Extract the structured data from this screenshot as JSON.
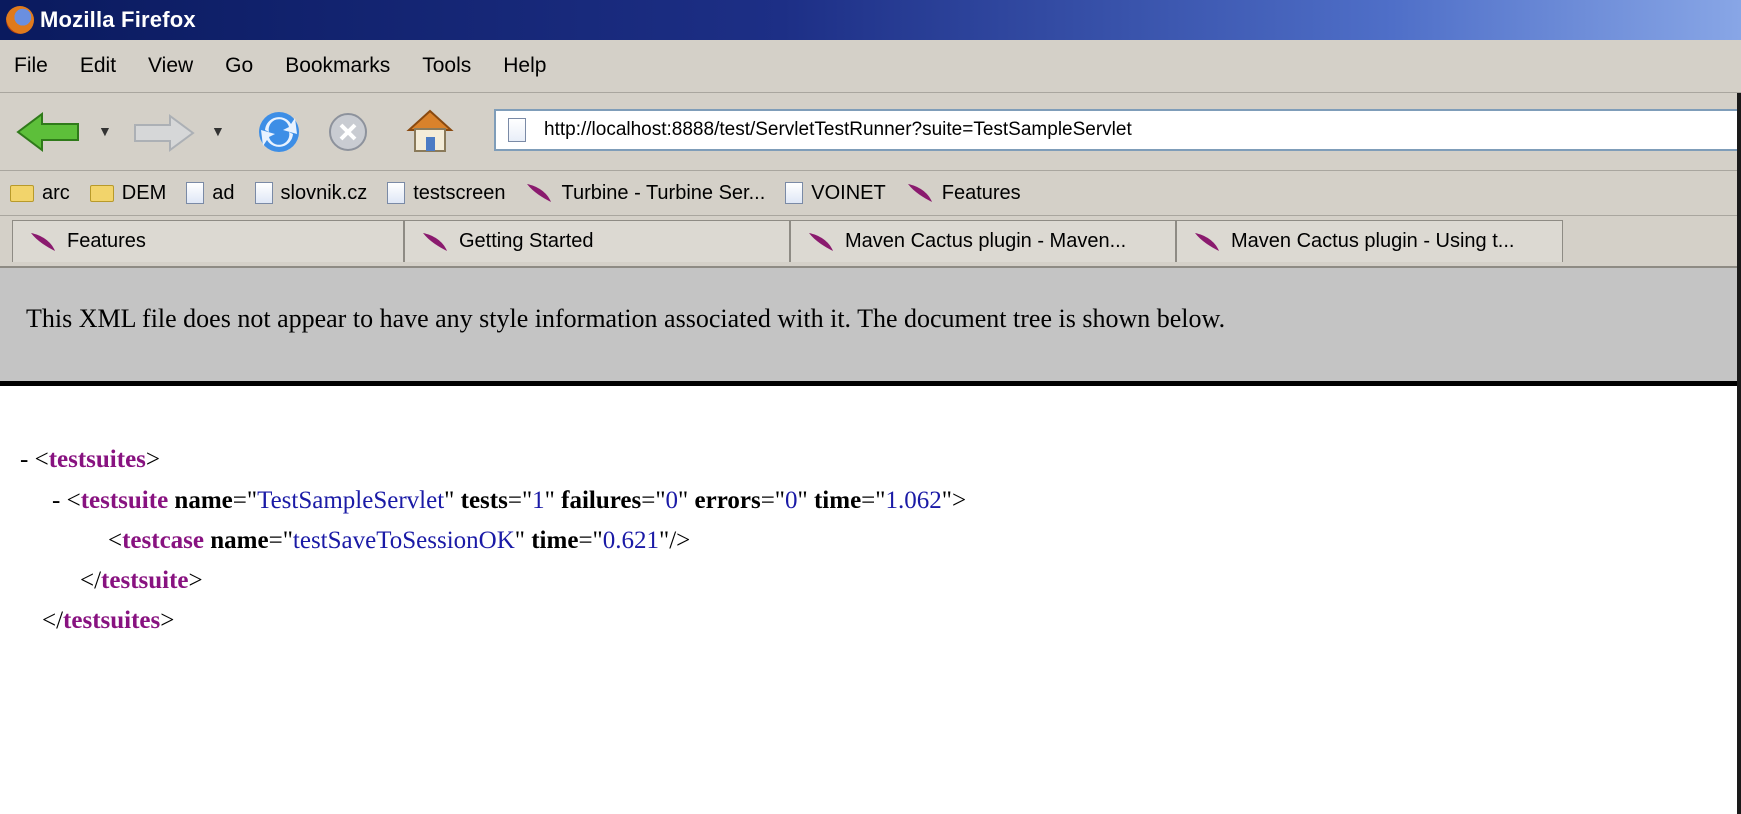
{
  "window": {
    "title": "Mozilla Firefox"
  },
  "menu": [
    {
      "label": "File"
    },
    {
      "label": "Edit"
    },
    {
      "label": "View"
    },
    {
      "label": "Go"
    },
    {
      "label": "Bookmarks"
    },
    {
      "label": "Tools"
    },
    {
      "label": "Help"
    }
  ],
  "navigation": {
    "url": "http://localhost:8888/test/ServletTestRunner?suite=TestSampleServlet",
    "buttons": [
      "back-icon",
      "forward-icon",
      "reload-icon",
      "stop-icon",
      "home-icon"
    ]
  },
  "bookmarks": [
    {
      "label": "arc",
      "icon": "folder-icon"
    },
    {
      "label": "DEM",
      "icon": "folder-icon"
    },
    {
      "label": "ad",
      "icon": "page-icon"
    },
    {
      "label": "slovnik.cz",
      "icon": "page-icon"
    },
    {
      "label": "testscreen",
      "icon": "page-icon"
    },
    {
      "label": "Turbine - Turbine Ser...",
      "icon": "feather-icon"
    },
    {
      "label": "VOINET",
      "icon": "page-icon"
    },
    {
      "label": "Features",
      "icon": "feather-icon"
    }
  ],
  "tabs": [
    {
      "label": "Features"
    },
    {
      "label": "Getting Started"
    },
    {
      "label": "Maven Cactus plugin - Maven..."
    },
    {
      "label": "Maven Cactus plugin - Using t..."
    }
  ],
  "notice": "This XML file does not appear to have any style information associated with it. The document tree is shown below.",
  "xml": {
    "root_tag": "testsuites",
    "suite_tag": "testsuite",
    "suite_name": "TestSampleServlet",
    "suite_tests": "1",
    "suite_failures": "0",
    "suite_errors": "0",
    "suite_time": "1.062",
    "case_tag": "testcase",
    "case_name": "testSaveToSessionOK",
    "case_time": "0.621",
    "attr_name": "name",
    "attr_tests": "tests",
    "attr_failures": "failures",
    "attr_errors": "errors",
    "attr_time": "time"
  },
  "colors": {
    "tag": "#881280",
    "value": "#1a1aa6",
    "chrome": "#d4d0c8",
    "feather": "#8a1a6e"
  }
}
